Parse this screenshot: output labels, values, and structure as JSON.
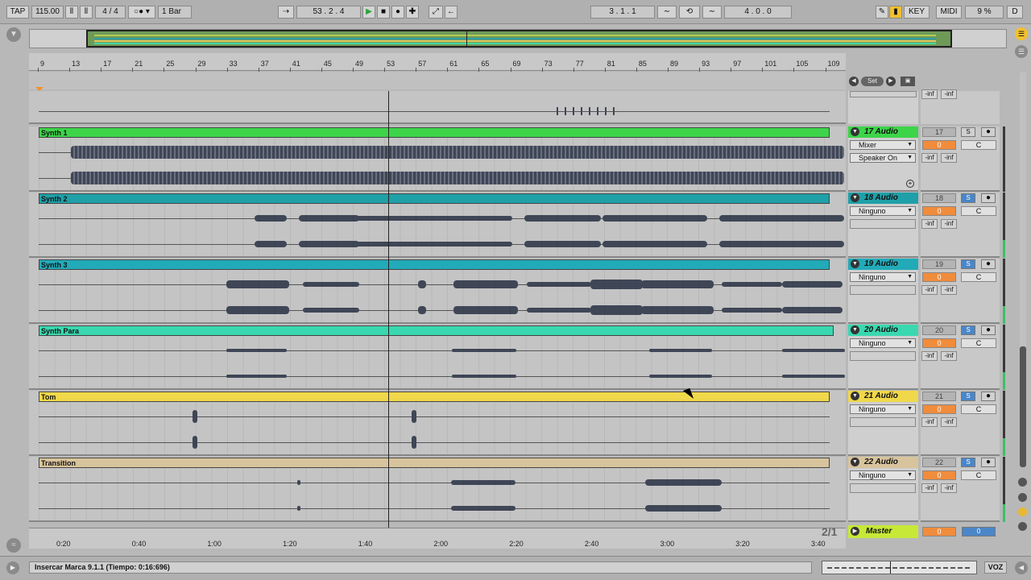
{
  "toolbar": {
    "tap": "TAP",
    "tempo": "115.00",
    "meter": "4 / 4",
    "quantize": "1 Bar",
    "position": "53 .  2 .  4",
    "loop_start": "3 .  1 .  1",
    "loop_length": "4 .  0 .  0",
    "key": "KEY",
    "midi": "MIDI",
    "cpu": "9 %",
    "d": "D"
  },
  "ruler": {
    "bars": [
      "9",
      "13",
      "17",
      "21",
      "25",
      "29",
      "33",
      "37",
      "41",
      "45",
      "49",
      "53",
      "57",
      "61",
      "65",
      "69",
      "73",
      "77",
      "81",
      "85",
      "89",
      "93",
      "97",
      "101",
      "105",
      "109"
    ],
    "times": [
      "0:20",
      "0:40",
      "1:00",
      "1:20",
      "1:40",
      "2:00",
      "2:20",
      "2:40",
      "3:00",
      "3:20",
      "3:40"
    ]
  },
  "locator": {
    "set": "Set"
  },
  "tracks": [
    {
      "clip": "Synth 1",
      "name": "17 Audio",
      "num": "17",
      "input": "Mixer",
      "monitor": "Speaker On",
      "vol": "0",
      "pan": "C",
      "inf1": "-inf",
      "inf2": "-inf",
      "color": "#3dd44a",
      "hdr": "#3dd44a"
    },
    {
      "clip": "Synth 2",
      "name": "18 Audio",
      "num": "18",
      "input": "Ninguno",
      "vol": "0",
      "pan": "C",
      "inf1": "-inf",
      "inf2": "-inf",
      "color": "#1fa0a8",
      "hdr": "#1fa0a8"
    },
    {
      "clip": "Synth 3",
      "name": "19 Audio",
      "num": "19",
      "input": "Ninguno",
      "vol": "0",
      "pan": "C",
      "inf1": "-inf",
      "inf2": "-inf",
      "color": "#22aab8",
      "hdr": "#22aab8"
    },
    {
      "clip": "Synth Para",
      "name": "20 Audio",
      "num": "20",
      "input": "Ninguno",
      "vol": "0",
      "pan": "C",
      "inf1": "-inf",
      "inf2": "-inf",
      "color": "#3ad8b0",
      "hdr": "#3ad8b0"
    },
    {
      "clip": "Tom",
      "name": "21 Audio",
      "num": "21",
      "input": "Ninguno",
      "vol": "0",
      "pan": "C",
      "inf1": "-inf",
      "inf2": "-inf",
      "color": "#f0d84a",
      "hdr": "#f0d84a"
    },
    {
      "clip": "Transition",
      "name": "22 Audio",
      "num": "22",
      "input": "Ninguno",
      "vol": "0",
      "pan": "C",
      "inf1": "-inf",
      "inf2": "-inf",
      "color": "#d8c49c",
      "hdr": "#d8c49c"
    }
  ],
  "top_track": {
    "inf1": "-inf",
    "inf2": "-inf"
  },
  "master": {
    "name": "Master",
    "vol": "0",
    "pan": "0",
    "page": "2/1"
  },
  "status": {
    "text": "Insercar Marca 9.1.1 (Tiempo: 0:16:696)",
    "voz": "VOZ"
  }
}
